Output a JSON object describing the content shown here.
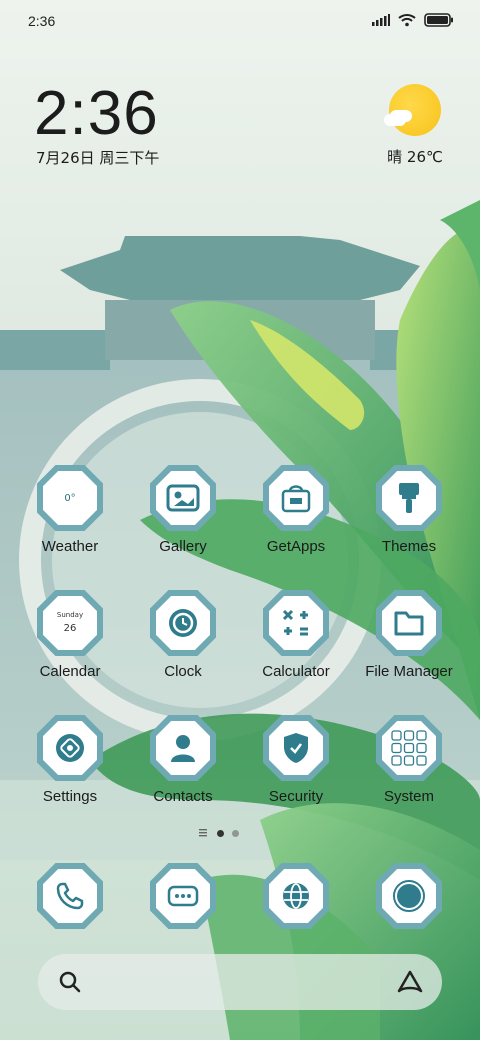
{
  "status_bar": {
    "time": "2:36"
  },
  "clock": {
    "time": "2:36",
    "date": "7月26日 周三下午"
  },
  "weather": {
    "text": "晴 26℃"
  },
  "apps_row1": [
    {
      "label": "Weather",
      "icon": "weather-icon",
      "value": "0°"
    },
    {
      "label": "Gallery",
      "icon": "gallery-icon"
    },
    {
      "label": "GetApps",
      "icon": "getapps-icon"
    },
    {
      "label": "Themes",
      "icon": "themes-icon"
    }
  ],
  "apps_row2": [
    {
      "label": "Calendar",
      "icon": "calendar-icon",
      "day_name": "Sunday",
      "day_num": "26"
    },
    {
      "label": "Clock",
      "icon": "clock-icon"
    },
    {
      "label": "Calculator",
      "icon": "calculator-icon"
    },
    {
      "label": "File Manager",
      "icon": "folder-icon"
    }
  ],
  "apps_row3": [
    {
      "label": "Settings",
      "icon": "settings-icon"
    },
    {
      "label": "Contacts",
      "icon": "contacts-icon"
    },
    {
      "label": "Security",
      "icon": "security-icon"
    },
    {
      "label": "System",
      "icon": "system-folder-icon"
    }
  ],
  "dock": [
    {
      "icon": "phone-icon"
    },
    {
      "icon": "messages-icon"
    },
    {
      "icon": "browser-icon"
    },
    {
      "icon": "camera-icon"
    }
  ],
  "page_indicator": {
    "pages": 2,
    "current": 1
  },
  "search": {
    "search_icon": "search-icon",
    "assistant_icon": "assistant-icon"
  },
  "colors": {
    "icon_accent": "#2f7c8c",
    "sun": "#f7c21a",
    "leaf": "#4ea860"
  }
}
